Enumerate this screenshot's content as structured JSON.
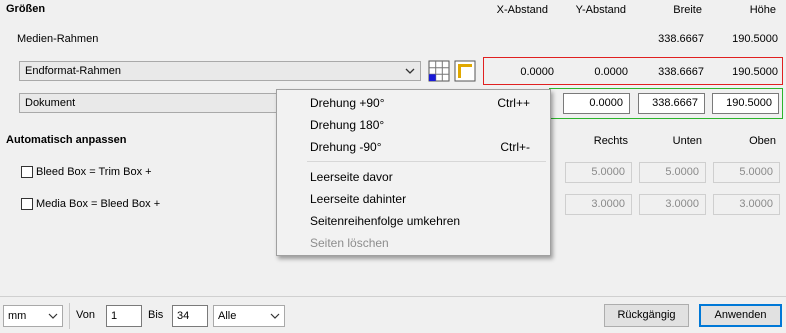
{
  "section_sizes": "Größen",
  "headers": {
    "x": "X-Abstand",
    "y": "Y-Abstand",
    "w": "Breite",
    "h": "Höhe"
  },
  "media_frame": {
    "label": "Medien-Rahmen",
    "w": "338.6667",
    "h": "190.5000"
  },
  "trim_row": {
    "selected": "Endformat-Rahmen",
    "x": "0.0000",
    "y": "0.0000",
    "w": "338.6667",
    "h": "190.5000"
  },
  "doc_row": {
    "selected": "Dokument",
    "y": "0.0000",
    "w": "338.6667",
    "h": "190.5000"
  },
  "auto": {
    "title": "Automatisch anpassen",
    "hdr_right": "Rechts",
    "hdr_bottom": "Unten",
    "hdr_top": "Oben",
    "bleed": {
      "label": "Bleed Box = Trim Box +",
      "right": "5.0000",
      "bottom": "5.0000",
      "top": "5.0000"
    },
    "media": {
      "label": "Media Box = Bleed Box +",
      "right": "3.0000",
      "bottom": "3.0000",
      "top": "3.0000"
    }
  },
  "context_menu": {
    "items": [
      {
        "label": "Drehung  +90°",
        "shortcut": "Ctrl++"
      },
      {
        "label": "Drehung  180°",
        "shortcut": ""
      },
      {
        "label": "Drehung  -90°",
        "shortcut": "Ctrl+-"
      },
      {
        "label": "Leerseite davor",
        "shortcut": ""
      },
      {
        "label": "Leerseite dahinter",
        "shortcut": ""
      },
      {
        "label": "Seitenreihenfolge umkehren",
        "shortcut": ""
      },
      {
        "label": "Seiten löschen",
        "shortcut": ""
      }
    ]
  },
  "bottom": {
    "unit": "mm",
    "from_label": "Von",
    "from": "1",
    "to_label": "Bis",
    "to": "34",
    "pages": "Alle",
    "undo": "Rückgängig",
    "apply": "Anwenden"
  },
  "colors": {
    "red_border": "#e02020",
    "green_border": "#2db52d",
    "apply_border": "#0078d7"
  }
}
